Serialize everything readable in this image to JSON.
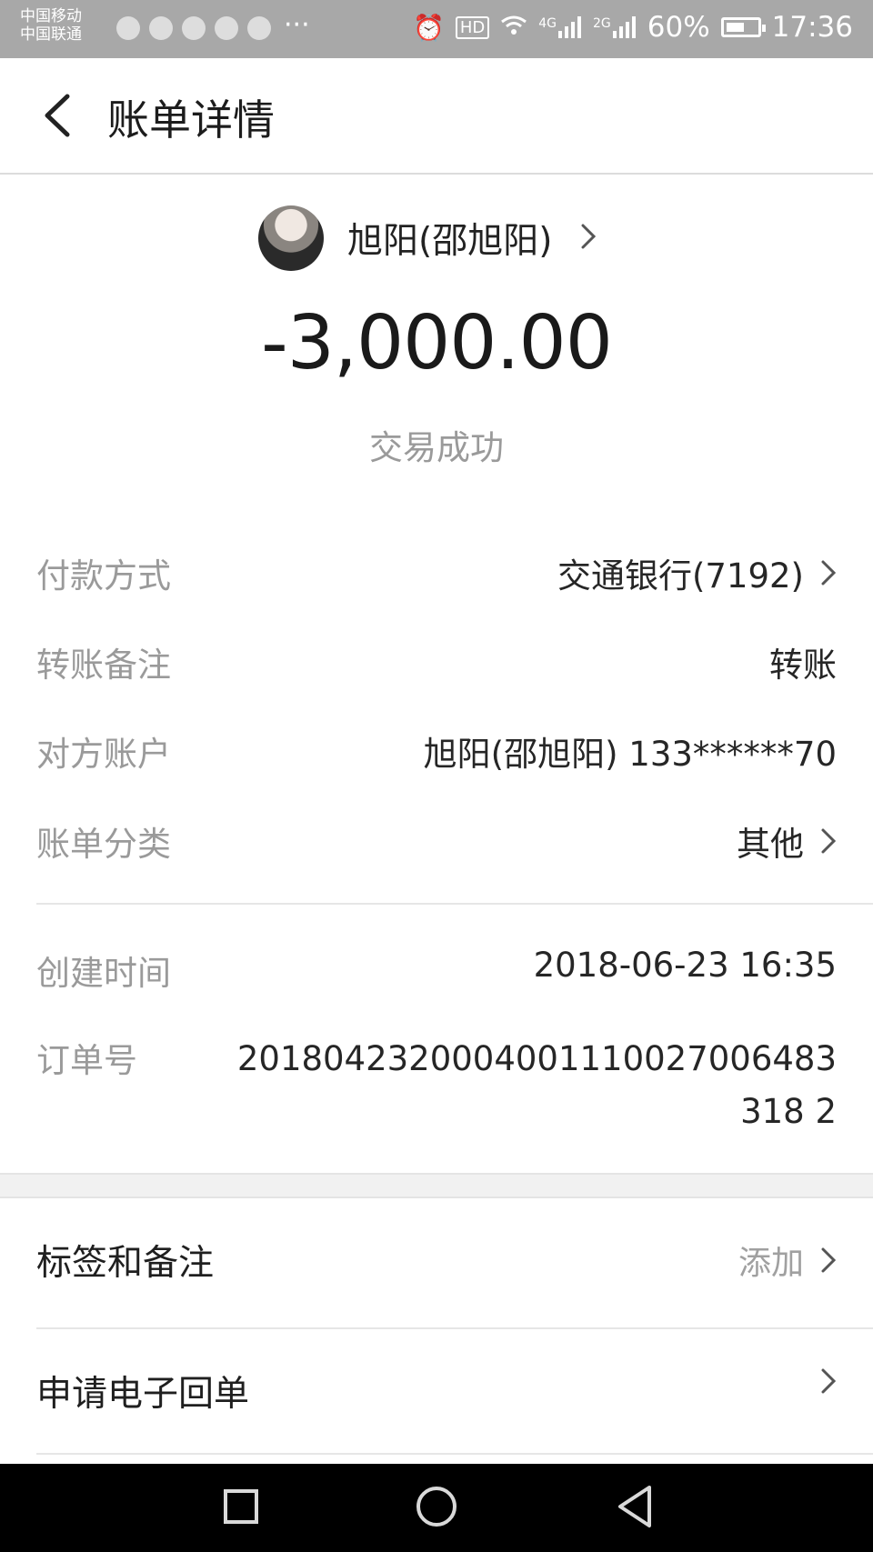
{
  "status_bar": {
    "carrier_1": "中国移动",
    "carrier_2": "中国联通",
    "more": "···",
    "network_1": "4G",
    "network_2": "2G",
    "battery_percent": "60%",
    "battery_level": 0.6,
    "time": "17:36",
    "icons": [
      "weather-icon",
      "browser-icon",
      "chat-icon",
      "app-icon",
      "photo-icon",
      "alarm-icon",
      "hd-icon",
      "wifi-icon",
      "signal-icon",
      "battery-icon"
    ]
  },
  "header": {
    "title": "账单详情"
  },
  "payee": {
    "name": "旭阳(邵旭阳)"
  },
  "transaction": {
    "amount": "-3,000.00",
    "status": "交易成功"
  },
  "details": [
    {
      "label": "付款方式",
      "value": "交通银行(7192)"
    },
    {
      "label": "转账备注",
      "value": "转账"
    },
    {
      "label": "对方账户",
      "value": "旭阳(邵旭阳) 133******70"
    },
    {
      "label": "账单分类",
      "value": "其他"
    }
  ],
  "meta": {
    "created_label": "创建时间",
    "created_value": "2018-06-23 16:35",
    "order_label": "订单号",
    "order_value": "2018042320004001110027006483318 2"
  },
  "actions": {
    "tags_label": "标签和备注",
    "tags_value": "添加",
    "receipt_label": "申请电子回单"
  },
  "colors": {
    "status_bar_bg": "#a8a8a8",
    "text_primary": "#262626",
    "text_secondary": "#9a9a9a",
    "nav_bg": "#000000"
  }
}
